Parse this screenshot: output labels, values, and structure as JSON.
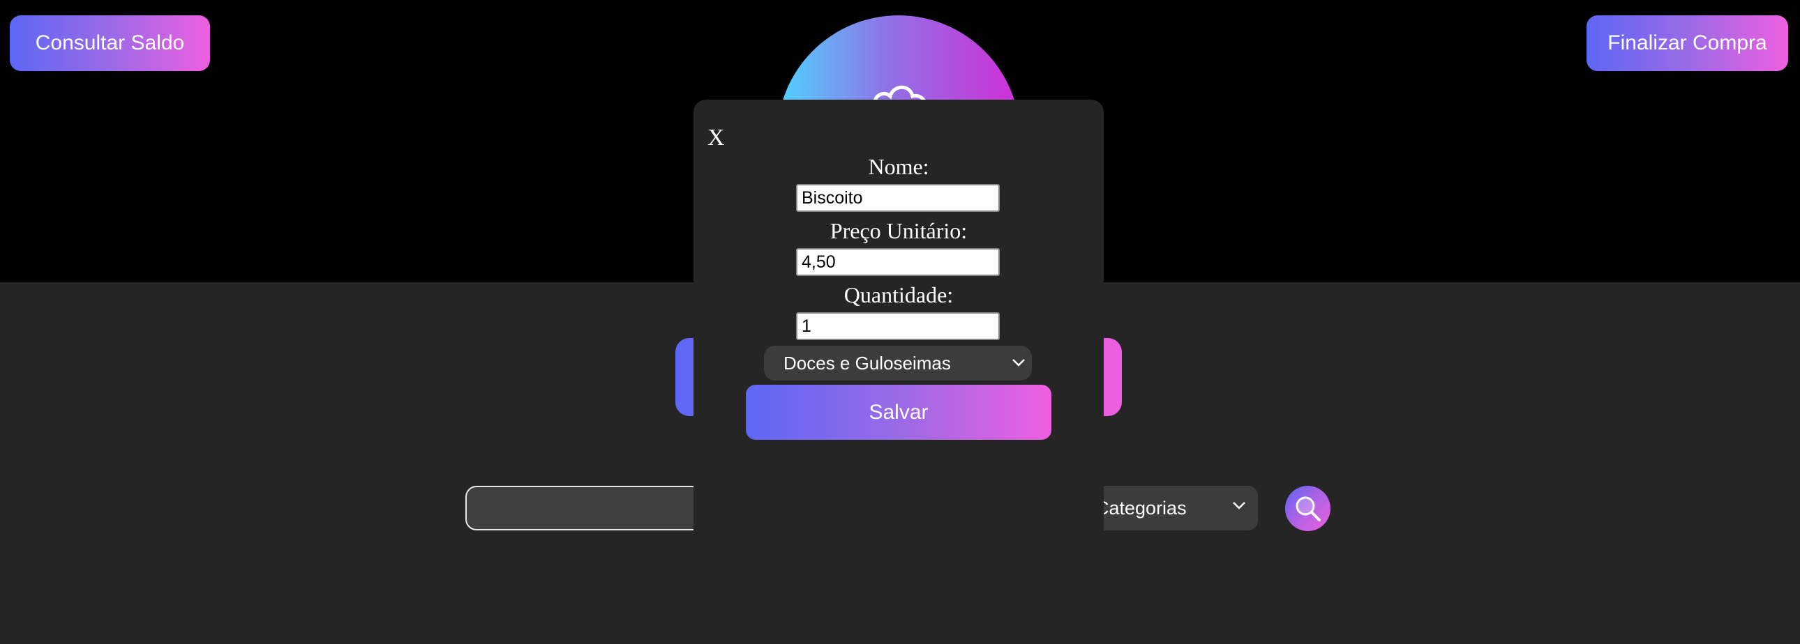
{
  "header": {
    "left_button": "Consultar Saldo",
    "right_button": "Finalizar Compra",
    "logo_icon": "cloud-logo-icon"
  },
  "search": {
    "input_value": "",
    "category_select": "Categorias",
    "search_icon": "magnifier-icon"
  },
  "modal": {
    "close_label": "X",
    "name_label": "Nome:",
    "name_value": "Biscoito",
    "price_label": "Preço Unitário:",
    "price_value": "4,50",
    "quantity_label": "Quantidade:",
    "quantity_value": "1",
    "category_value": "Doces e Guloseimas",
    "save_label": "Salvar"
  },
  "colors": {
    "header_bg": "#000000",
    "page_bg": "#252525",
    "gradient_start": "#5e67f5",
    "gradient_end": "#ee5fe0",
    "logo_gradient_start": "#4fd4ff",
    "logo_gradient_end": "#d12fd8"
  }
}
